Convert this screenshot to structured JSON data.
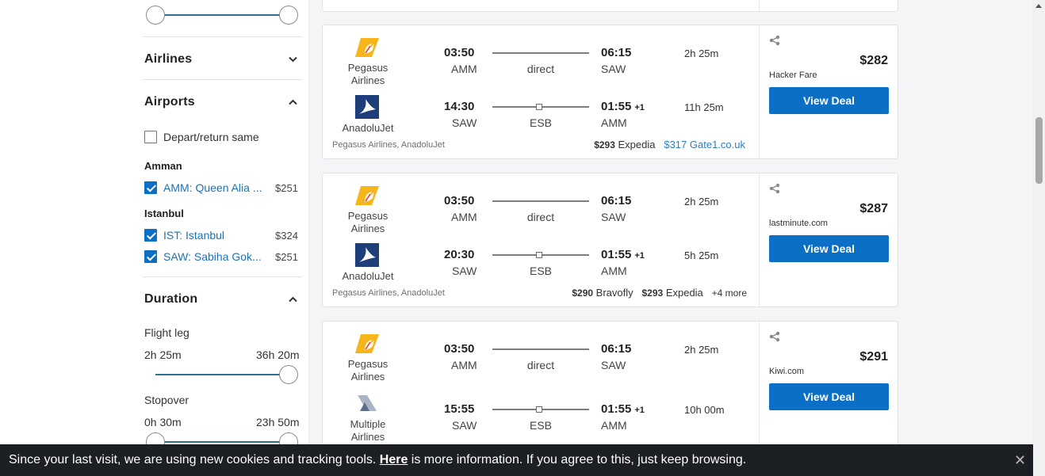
{
  "filters": {
    "airlines": {
      "title": "Airlines"
    },
    "airports": {
      "title": "Airports",
      "same_label": "Depart/return same",
      "groups": [
        {
          "city": "Amman",
          "items": [
            {
              "label": "AMM: Queen Alia ...",
              "price": "$251"
            }
          ]
        },
        {
          "city": "Istanbul",
          "items": [
            {
              "label": "IST: Istanbul",
              "price": "$324"
            },
            {
              "label": "SAW: Sabiha Gok...",
              "price": "$251"
            }
          ]
        }
      ]
    },
    "duration": {
      "title": "Duration",
      "flight_leg": {
        "label": "Flight leg",
        "min": "2h 25m",
        "max": "36h 20m"
      },
      "stopover": {
        "label": "Stopover",
        "min": "0h 30m",
        "max": "23h 50m"
      }
    }
  },
  "results": [
    {
      "outbound": {
        "airline": "Pegasus Airlines",
        "logo": "pegasus-logo",
        "dep_time": "03:50",
        "dep_code": "AMM",
        "arr_time": "06:15",
        "arr_code": "SAW",
        "via": "direct",
        "duration": "2h 25m"
      },
      "return": {
        "airline": "AnadoluJet",
        "logo": "anadolujet-logo",
        "dep_time": "14:30",
        "dep_code": "SAW",
        "arr_time": "01:55",
        "plus_day": "+1",
        "arr_code": "AMM",
        "via": "ESB",
        "duration": "11h 25m"
      },
      "operators": "Pegasus Airlines, AnadoluJet",
      "alt_prices": [
        {
          "price": "$293",
          "site": "Expedia"
        },
        {
          "price": "$317",
          "site": "Gate1.co.uk"
        }
      ],
      "price": "$282",
      "provider": "Hacker Fare",
      "button": "View Deal"
    },
    {
      "outbound": {
        "airline": "Pegasus Airlines",
        "logo": "pegasus-logo",
        "dep_time": "03:50",
        "dep_code": "AMM",
        "arr_time": "06:15",
        "arr_code": "SAW",
        "via": "direct",
        "duration": "2h 25m"
      },
      "return": {
        "airline": "AnadoluJet",
        "logo": "anadolujet-logo",
        "dep_time": "20:30",
        "dep_code": "SAW",
        "arr_time": "01:55",
        "plus_day": "+1",
        "arr_code": "AMM",
        "via": "ESB",
        "duration": "5h 25m"
      },
      "operators": "Pegasus Airlines, AnadoluJet",
      "alt_prices": [
        {
          "price": "$290",
          "site": "Bravofly"
        },
        {
          "price": "$293",
          "site": "Expedia"
        }
      ],
      "more": "+4 more",
      "price": "$287",
      "provider": "lastminute.com",
      "button": "View Deal"
    },
    {
      "outbound": {
        "airline": "Pegasus Airlines",
        "logo": "pegasus-logo",
        "dep_time": "03:50",
        "dep_code": "AMM",
        "arr_time": "06:15",
        "arr_code": "SAW",
        "via": "direct",
        "duration": "2h 25m"
      },
      "return": {
        "airline": "Multiple Airlines",
        "logo": "multiple-airlines-logo",
        "dep_time": "15:55",
        "dep_code": "SAW",
        "arr_time": "01:55",
        "plus_day": "+1",
        "arr_code": "AMM",
        "via": "ESB",
        "duration": "10h 00m"
      },
      "price": "$291",
      "provider": "Kiwi.com",
      "button": "View Deal"
    }
  ],
  "cookie_banner": {
    "before": "Since your last visit, we are using new cookies and tracking tools. ",
    "link": "Here",
    "after": " is more information. If you agree to this, just keep browsing.",
    "close": "✕"
  },
  "colors": {
    "accent": "#0b6fc5",
    "slider": "#2a7092",
    "banner": "#1c1f23"
  }
}
